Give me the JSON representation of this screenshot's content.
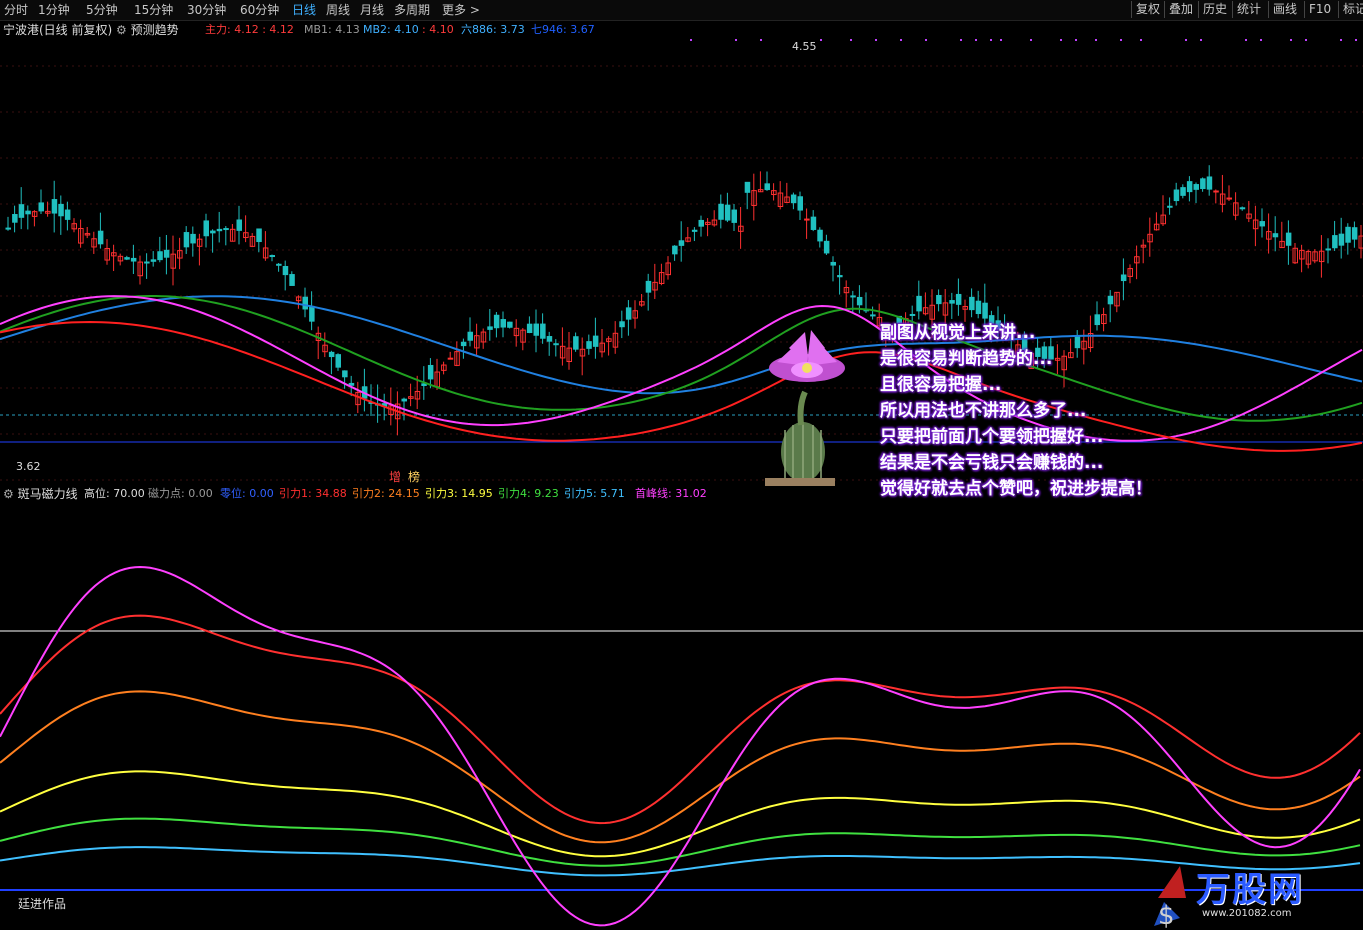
{
  "toolbar": {
    "tabs": [
      "分时",
      "1分钟",
      "5分钟",
      "15分钟",
      "30分钟",
      "60分钟",
      "日线",
      "周线",
      "月线",
      "多周期",
      "更多 >"
    ],
    "active_tab": "日线",
    "right_buttons": [
      "复权",
      "叠加",
      "历史",
      "统计",
      "画线",
      "F10",
      "标记"
    ]
  },
  "main_header": {
    "title": "宁波港(日线 前复权)",
    "indicator": "预测趋势",
    "items": [
      {
        "text": "主力: 4.12 : 4.12",
        "color": "#ff3b3b"
      },
      {
        "text": "MB1: 4.13",
        "color": "#9a9a9a"
      },
      {
        "text": "MB2: 4.10",
        "color": "#3fb0ff"
      },
      {
        "text": ": 4.10",
        "color": "#ff3b3b"
      },
      {
        "text": "六886: 3.73",
        "color": "#3fb0ff"
      },
      {
        "text": "七946: 3.67",
        "color": "#2060ff"
      }
    ]
  },
  "price_labels": {
    "high": "4.55",
    "low": "3.62"
  },
  "markers": [
    {
      "text": "增",
      "color": "#ff4040"
    },
    {
      "text": "榜",
      "color": "#ffd060"
    }
  ],
  "sub_header": {
    "name": "斑马磁力线",
    "items": [
      {
        "text": "高位: 70.00",
        "color": "#dcdcdc"
      },
      {
        "text": "磁力点: 0.00",
        "color": "#9a9a9a"
      },
      {
        "text": "零位: 0.00",
        "color": "#3060ff"
      },
      {
        "text": "引力1: 34.88",
        "color": "#ff3030"
      },
      {
        "text": "引力2: 24.15",
        "color": "#ff8020"
      },
      {
        "text": "引力3: 14.95",
        "color": "#ffff40"
      },
      {
        "text": "引力4: 9.23",
        "color": "#40e040"
      },
      {
        "text": "引力5: 5.71",
        "color": "#40c0ff"
      },
      {
        "text": "首峰线: 31.02",
        "color": "#ff40ff"
      }
    ]
  },
  "overlay_lines": [
    "副图从视觉上来讲...",
    "是很容易判断趋势的...",
    "且很容易把握...",
    "所以用法也不讲那么多了...",
    "只要把前面几个要领把握好...",
    "结果是不会亏钱只会赚钱的...",
    "觉得好就去点个赞吧，祝进步提高！"
  ],
  "footer_label": "廷进作品",
  "watermark": {
    "brand": "万股网",
    "url": "www.201082.com"
  },
  "colors": {
    "up": "#ff3030",
    "down": "#20c0c0",
    "ma_red": "#ff2020",
    "ma_magenta": "#ff40ff",
    "ma_green": "#20a020",
    "ma_blue": "#2080e0"
  }
}
